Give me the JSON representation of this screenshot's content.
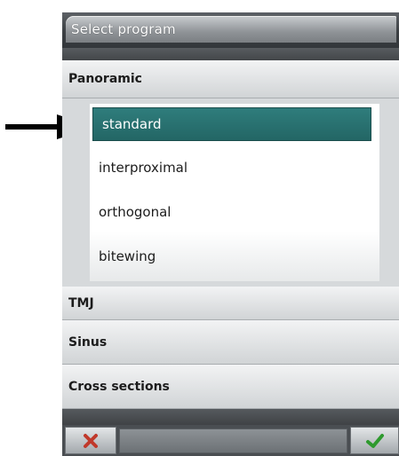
{
  "title": "Select program",
  "categories": {
    "panoramic": "Panoramic",
    "tmj": "TMJ",
    "sinus": "Sinus",
    "cross_sections": "Cross sections"
  },
  "panoramic_programs": [
    "standard",
    "interproximal",
    "orthogonal",
    "bitewing"
  ],
  "selected_program": "standard",
  "icons": {
    "cancel": "close-x-icon",
    "confirm": "checkmark-icon",
    "pointer": "arrow-right-icon"
  },
  "colors": {
    "selected_bg": "#2a7372",
    "cancel_icon": "#c0392b",
    "confirm_icon": "#2e9a2e"
  }
}
